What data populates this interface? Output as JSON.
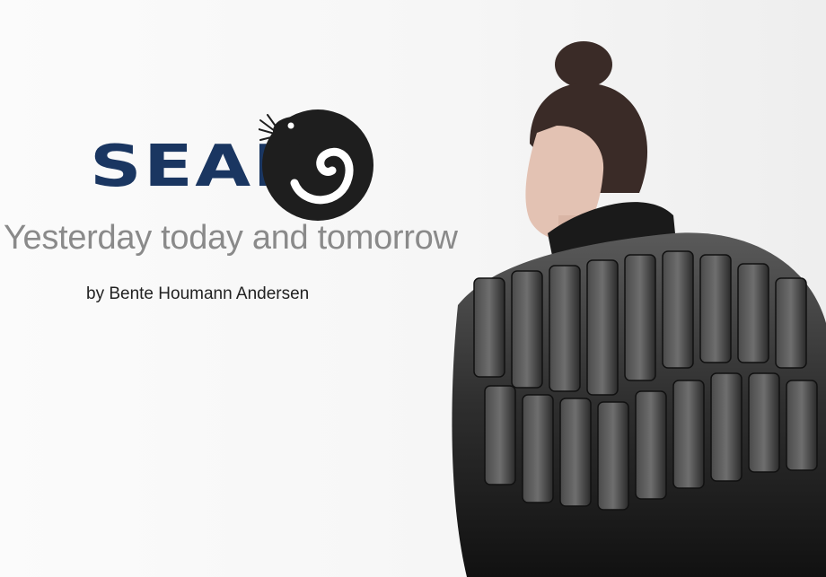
{
  "logo": {
    "wordmark": "SEAL",
    "brand_color": "#1a3661",
    "mark_color": "#1e1e1e",
    "mark_icon": "seal-icon"
  },
  "tagline": "Yesterday today and tomorrow",
  "byline": "by Bente Houmann Andersen",
  "colors": {
    "background": "#f7f7f7",
    "tagline": "#8a8a8a",
    "byline": "#222222",
    "garment": "#2b2b2b",
    "skin": "#e3c2b3",
    "hair": "#3a2b27"
  },
  "photo": {
    "subject": "model-in-fur-garment"
  }
}
